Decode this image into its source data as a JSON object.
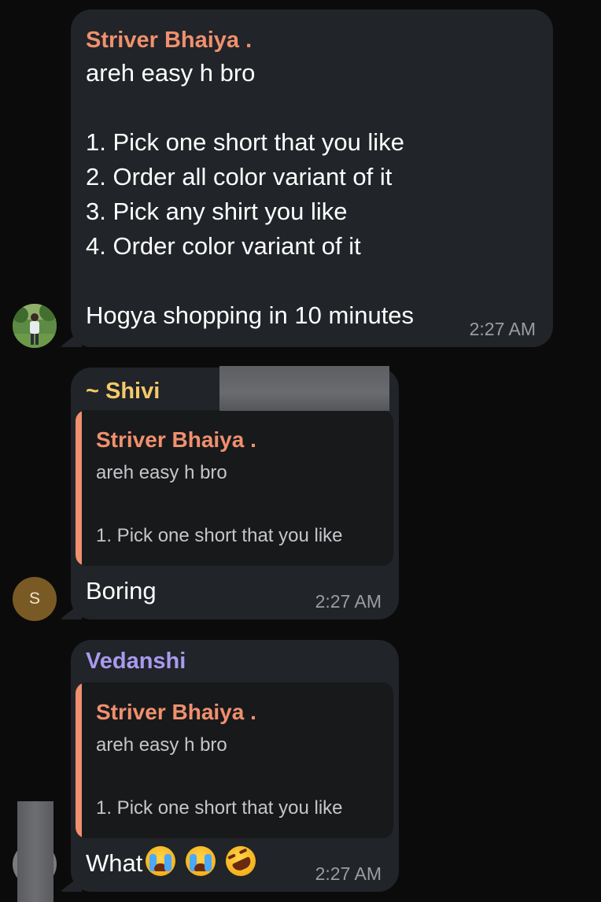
{
  "messages": [
    {
      "sender": "Striver Bhaiya .",
      "sender_color": "#f0906e",
      "lines": [
        "areh easy h bro",
        "",
        "1. Pick one short that you like",
        "2. Order all color variant of it",
        "3. Pick any shirt you like",
        "4. Order color variant of it",
        "",
        "Hogya shopping in 10 minutes"
      ],
      "time": "2:27 AM",
      "avatar": {
        "type": "photo"
      }
    },
    {
      "sender": "~ Shivi",
      "sender_color": "#f5c96a",
      "reply": {
        "sender": "Striver Bhaiya .",
        "sender_color": "#f0906e",
        "line1": "areh easy h bro",
        "line2": "1. Pick one short that you like"
      },
      "text": "Boring",
      "time": "2:27 AM",
      "avatar": {
        "type": "initial",
        "initial": "S",
        "color": "#7a5a24"
      }
    },
    {
      "sender": "Vedanshi",
      "sender_color": "#a99af0",
      "reply": {
        "sender": "Striver Bhaiya .",
        "sender_color": "#f0906e",
        "line1": "areh easy h bro",
        "line2": "1. Pick one short that you like"
      },
      "text": "What",
      "emojis": [
        "loudly-crying-face",
        "loudly-crying-face",
        "rolling-on-the-floor-laughing"
      ],
      "time": "2:27 AM"
    }
  ]
}
